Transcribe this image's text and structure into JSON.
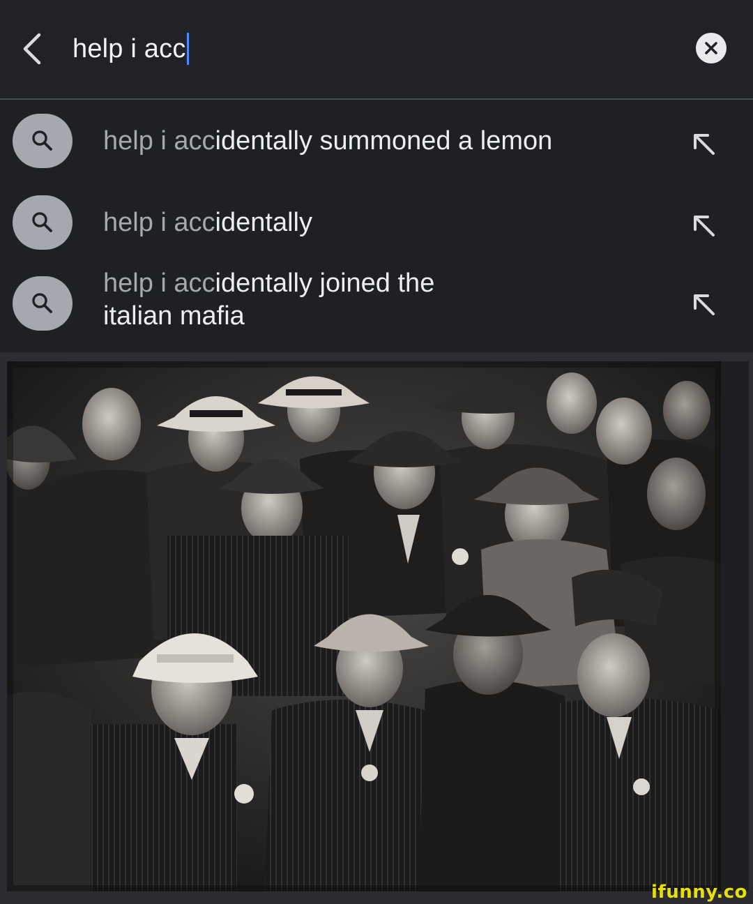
{
  "search": {
    "query": "help i acc"
  },
  "suggestions": [
    {
      "typed": "help i acc",
      "completion": "identally summoned a lemon"
    },
    {
      "typed": "help i acc",
      "completion": "identally"
    },
    {
      "typed": "help i acc",
      "completion": "identally joined the\nitalian mafia"
    }
  ],
  "icons": {
    "back": "chevron-left-icon",
    "clear": "clear-x-icon",
    "search": "magnifier-icon",
    "fill": "arrow-up-left-icon"
  },
  "colors": {
    "background": "#1f2125",
    "caret": "#4a8cff",
    "typed_text": "#a5a8ae",
    "watermark": "#e8e000"
  },
  "watermark": {
    "text": "ifunny.co"
  }
}
